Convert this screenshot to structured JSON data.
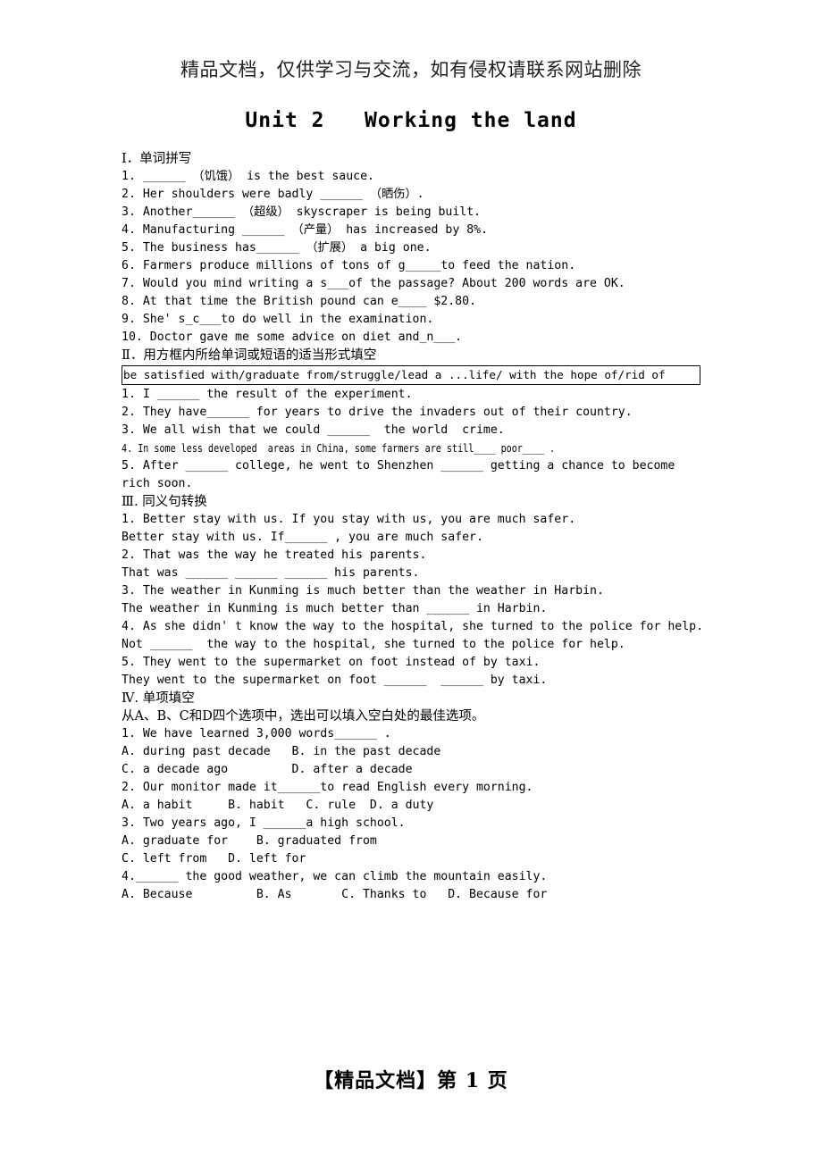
{
  "header": {
    "watermark": "精品文档，仅供学习与交流，如有侵权请联系网站删除"
  },
  "title": "Unit 2   Working the land",
  "sections": [
    {
      "id": "section-1",
      "heading": "Ⅰ．单词拼写",
      "lines": [
        "1. ______ （饥饿） is the best sauce.",
        "2. Her shoulders were badly ______ （晒伤）.",
        "3. Another______ （超级） skyscraper is being built.",
        "4. Manufacturing ______ （产量） has increased by 8%.",
        "5. The business has______ （扩展） a big one.",
        "6. Farmers produce millions of tons of g_____to feed the nation.",
        "7. Would you mind writing a s___of the passage? About 200 words are OK.",
        "8. At that time the British pound can e____ $2.80.",
        "9. She' s_c___to do well in the examination.",
        "10. Doctor gave me some advice on diet and_n___."
      ]
    },
    {
      "id": "section-2",
      "heading": "Ⅱ．用方框内所给单词或短语的适当形式填空",
      "wordbox": "be satisfied with/graduate from/struggle/lead a ...life/ with the hope of/rid of",
      "lines": [
        "1. I ______ the result of the experiment.",
        "2. They have______ for years to drive the invaders out of their country.",
        "3. We all wish that we could ______  the world  crime.",
        "4. In some less developed  areas in China, some farmers are still____ poor____ .",
        "5. After ______ college, he went to Shenzhen ______ getting a chance to become",
        "rich soon."
      ]
    },
    {
      "id": "section-3",
      "heading": "Ⅲ. 同义句转换",
      "lines": [
        "1. Better stay with us. If you stay with us, you are much safer.",
        "Better stay with us. If______ , you are much safer.",
        "2. That was the way he treated his parents.",
        "That was ______ ______ ______ his parents.",
        "3. The weather in Kunming is much better than the weather in Harbin.",
        "The weather in Kunming is much better than ______ in Harbin.",
        "4. As she didn' t know the way to the hospital, she turned to the police for help.",
        "Not ______  the way to the hospital, she turned to the police for help.",
        "5. They went to the supermarket on foot instead of by taxi.",
        "They went to the supermarket on foot ______  ______ by taxi."
      ]
    },
    {
      "id": "section-4",
      "heading": "Ⅳ. 单项填空",
      "instruction": "从A、B、C和D四个选项中，选出可以填入空白处的最佳选项。",
      "questions": [
        {
          "stem": "1. We have learned 3,000 words______ .",
          "options": [
            "A. during past decade   B. in the past decade",
            "C. a decade ago         D. after a decade"
          ]
        },
        {
          "stem": "2. Our monitor made it______to read English every morning.",
          "options": [
            "A. a habit     B. habit   C. rule  D. a duty"
          ]
        },
        {
          "stem": "3. Two years ago, I ______a high school.",
          "options": [
            "A. graduate for    B. graduated from",
            "C. left from   D. left for"
          ]
        },
        {
          "stem": "4.______ the good weather, we can climb the mountain easily.",
          "options": [
            "A. Because         B. As       C. Thanks to   D. Because for"
          ]
        }
      ]
    }
  ],
  "footer": "【精品文档】第 1 页"
}
